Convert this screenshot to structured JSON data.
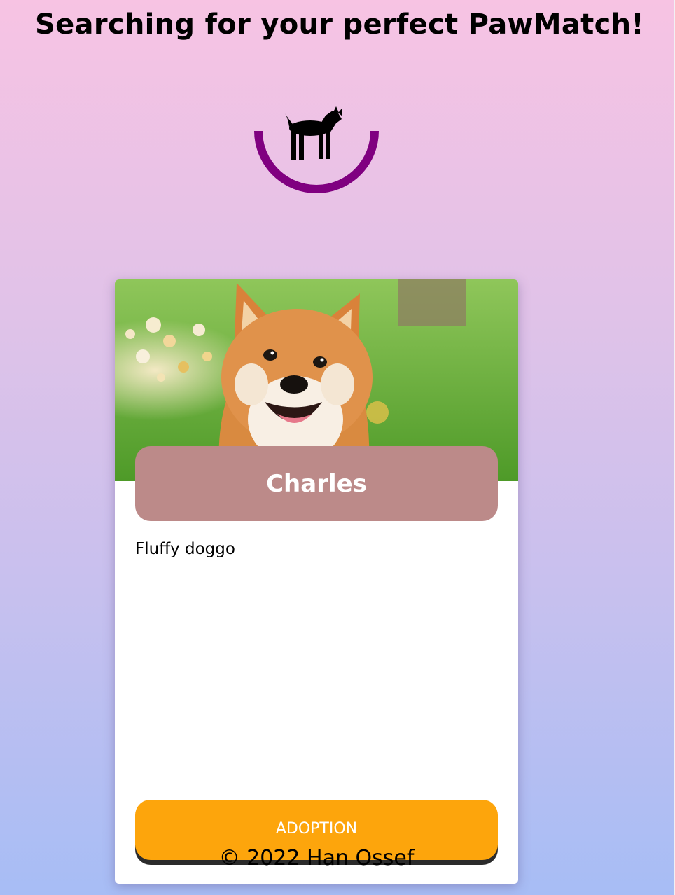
{
  "header": {
    "title": "Searching for your perfect PawMatch!"
  },
  "loader": {
    "icon": "dog-icon",
    "ring_color": "#800080",
    "progress": 0.5
  },
  "card": {
    "image": "shiba-inu-photo",
    "name": "Charles",
    "description": "Fluffy doggo",
    "button_label": "ADOPTION"
  },
  "footer": {
    "text": "© 2022 Han Ossef"
  },
  "colors": {
    "name_banner": "#bc8a89",
    "button": "#fda50c",
    "button_shadow": "#2b2b2b"
  }
}
